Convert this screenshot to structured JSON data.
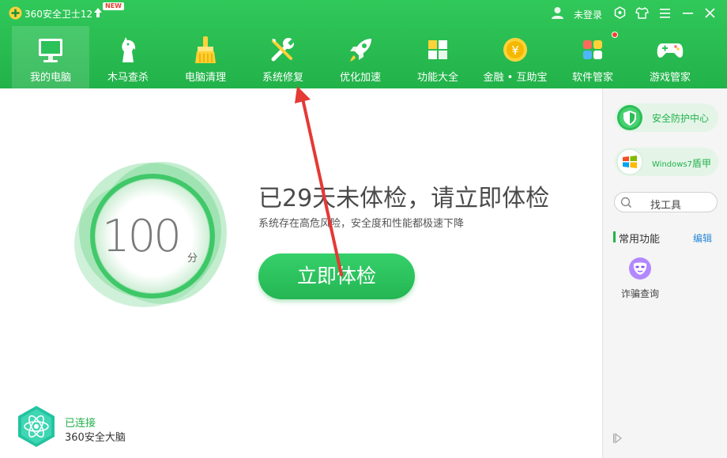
{
  "app": {
    "title": "360安全卫士12",
    "new_badge": "NEW",
    "login_text": "未登录"
  },
  "icons": {
    "logo": "plus-shield-logo",
    "update": "up-arrow-icon",
    "user": "user-icon",
    "skin": "skin-icon",
    "shirt": "shirt-icon",
    "menu": "menu-icon",
    "minimize": "minimize-icon",
    "close": "close-icon"
  },
  "nav": {
    "items": [
      {
        "label": "我的电脑",
        "icon": "monitor-icon",
        "active": true
      },
      {
        "label": "木马查杀",
        "icon": "horse-icon"
      },
      {
        "label": "电脑清理",
        "icon": "broom-icon"
      },
      {
        "label": "系统修复",
        "icon": "wrench-icon"
      },
      {
        "label": "优化加速",
        "icon": "rocket-icon"
      },
      {
        "label": "功能大全",
        "icon": "grid-icon"
      },
      {
        "label": "金融 • 互助宝",
        "icon": "coin-icon"
      },
      {
        "label": "软件管家",
        "icon": "apps-icon",
        "badge": true
      },
      {
        "label": "游戏管家",
        "icon": "gamepad-icon"
      }
    ]
  },
  "main": {
    "score": "100",
    "score_unit": "分",
    "headline": "已29天未体检，请立即体检",
    "subline": "系统存在高危风险，安全度和性能都极速下降",
    "check_button": "立即体检",
    "brain_status": "已连接",
    "brain_name": "360安全大脑"
  },
  "sidebar": {
    "protect": "安全防护中心",
    "win7_prefix": "Windows7",
    "win7_suffix": "盾甲",
    "search": "找工具",
    "common_title": "常用功能",
    "edit": "编辑",
    "fraud": "诈骗查询"
  },
  "colors": {
    "brand_green": "#22b24a",
    "annotation_red": "#e53935",
    "link_blue": "#2a88d8"
  }
}
